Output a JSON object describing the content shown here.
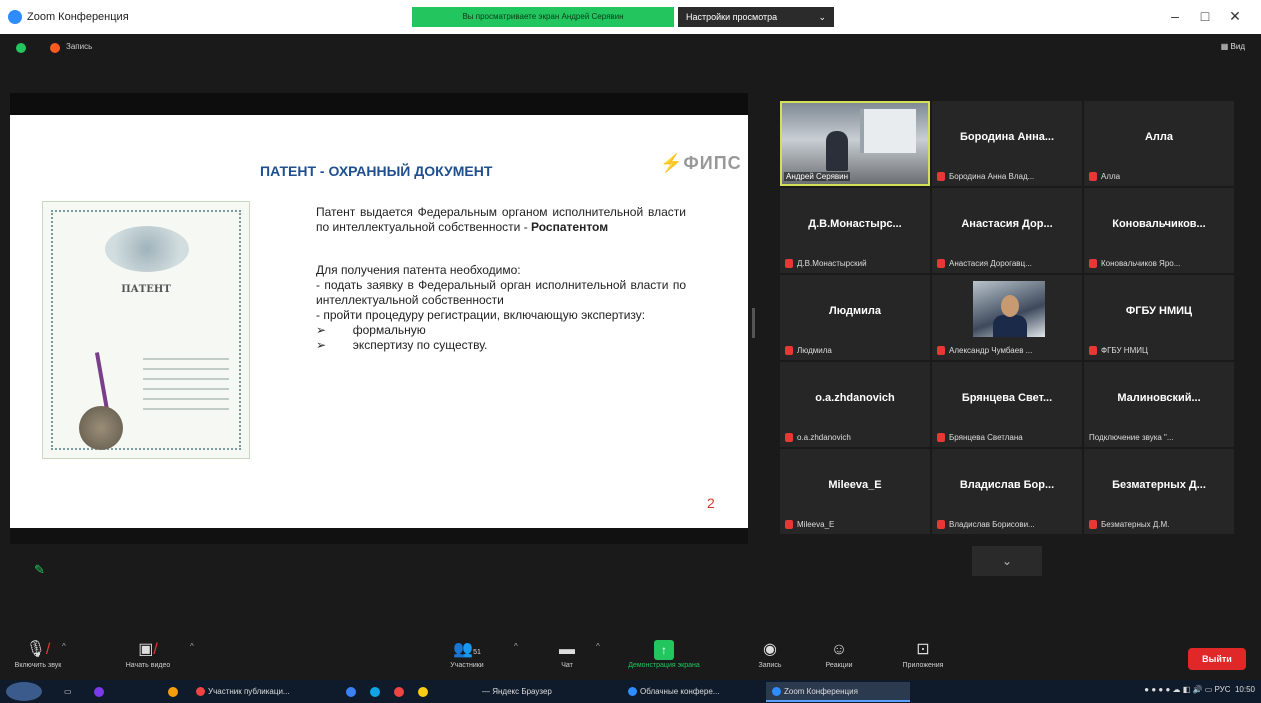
{
  "window": {
    "title": "Zoom Конференция",
    "view_banner": "Вы просматриваете экран Андрей Серявин",
    "view_options": "Настройки просмотра",
    "minimize": "–",
    "maximize": "□",
    "close": "✕"
  },
  "meeting_info": {
    "recording": "Запись",
    "view": "Вид"
  },
  "slide": {
    "title": "ПАТЕНТ - ОХРАННЫЙ ДОКУМЕНТ",
    "logo": "ФИПС",
    "patent_image_title": "ПАТЕНТ",
    "paragraph1_pre": "Патент выдается Федеральным органом исполнительной власти по интеллектуальной собственности - ",
    "paragraph1_bold": "Роспатентом",
    "paragraph2_lines": [
      "Для получения патента необходимо:",
      "- подать заявку в Федеральный орган исполнительной власти по интеллектуальной собственности",
      "- пройти процедуру регистрации, включающую экспертизу:"
    ],
    "bullets": [
      "формальную",
      "экспертизу по существу."
    ],
    "page_number": "2"
  },
  "participants": [
    {
      "big": "",
      "small": "Андрей Серявин",
      "video": true
    },
    {
      "big": "Бородина Анна...",
      "small": "Бородина Анна Влад..."
    },
    {
      "big": "Алла",
      "small": "Алла"
    },
    {
      "big": "Д.В.Монастырс...",
      "small": "Д.В.Монастырский"
    },
    {
      "big": "Анастасия Дор...",
      "small": "Анастасия Дорогавц..."
    },
    {
      "big": "Коновальчиков...",
      "small": "Коновальчиков Яро..."
    },
    {
      "big": "Людмила",
      "small": "Людмила"
    },
    {
      "big": "",
      "small": "Александр Чумбаев ...",
      "photo": true
    },
    {
      "big": "ФГБУ НМИЦ",
      "small": "ФГБУ НМИЦ"
    },
    {
      "big": "o.a.zhdanovich",
      "small": "o.a.zhdanovich"
    },
    {
      "big": "Брянцева Свет...",
      "small": "Брянцева Светлана"
    },
    {
      "big": "Малиновский...",
      "small": "Подключение звука \"..."
    },
    {
      "big": "Mileeva_E",
      "small": "Mileeva_E"
    },
    {
      "big": "Владислав Бор...",
      "small": "Владислав Борисови..."
    },
    {
      "big": "Безматерных Д...",
      "small": "Безматерных Д.М."
    }
  ],
  "gallery_more": "⌄",
  "toolbar": {
    "unmute": "Включить звук",
    "start_video": "Начать видео",
    "participants": "Участники",
    "participants_count": "51",
    "chat": "Чат",
    "share_screen": "Демонстрация экрана",
    "record": "Запись",
    "reactions": "Реакции",
    "apps": "Приложения",
    "leave": "Выйти"
  },
  "taskbar": {
    "items": [
      "Участник публикаци...",
      "— Яндекс Браузер",
      "Облачные конфере...",
      "Zoom Конференция"
    ],
    "lang": "РУС",
    "time": "10:50"
  },
  "colors": {
    "banner_green": "#22c55e",
    "leave_red": "#e02828",
    "slide_title_blue": "#1f4f8f",
    "active_speaker": "#d4e157"
  }
}
